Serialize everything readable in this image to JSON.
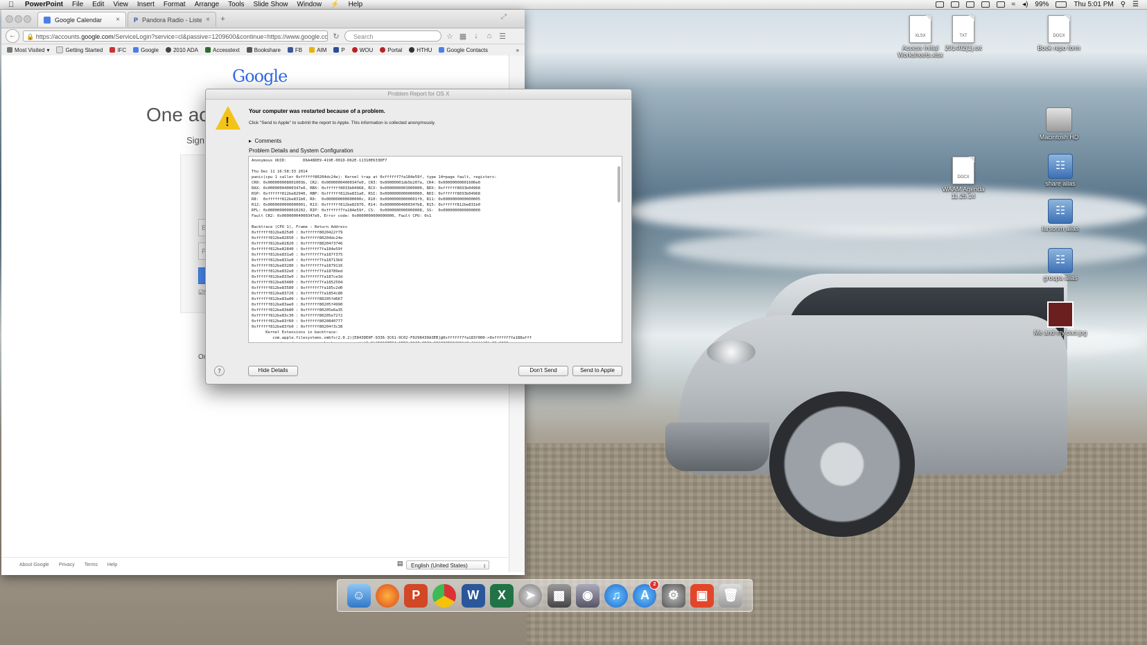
{
  "menubar": {
    "app": "PowerPoint",
    "items": [
      "File",
      "Edit",
      "View",
      "Insert",
      "Format",
      "Arrange",
      "Tools",
      "Slide Show",
      "Window",
      "Help"
    ],
    "battery": "99%",
    "clock": "Thu 5:01 PM"
  },
  "desktop": {
    "icons": [
      {
        "label": "Access Initial Worksheets.xlsx",
        "tag": "XLSX"
      },
      {
        "label": "201402(1).txt",
        "tag": "TXT"
      },
      {
        "label": "Book repo form",
        "tag": "DOCX"
      },
      {
        "label": "Macintosh HD"
      },
      {
        "label": "WAAM Agenda 11.25.14",
        "tag": "DOCX"
      },
      {
        "label": "share alias"
      },
      {
        "label": "larsonm alias"
      },
      {
        "label": "groupa alias"
      },
      {
        "label": "Me and my dad.jpg"
      }
    ]
  },
  "browser": {
    "tabs": [
      {
        "label": "Google Calendar"
      },
      {
        "label": "Pandora Radio - Listen to ..."
      }
    ],
    "url_prefix": "https://accounts.",
    "url_domain": "google.com",
    "url_rest": "/ServiceLogin?service=cl&passive=1209600&continue=https://www.google.com/caler",
    "search_placeholder": "Search",
    "bookmarks": [
      "Most Visited",
      "Getting Started",
      "IFC",
      "Google",
      "2010 ADA",
      "Accesstext",
      "Bookshare",
      "FB",
      "AIM",
      "P",
      "WOU",
      "Portal",
      "HTHU",
      "Google Contacts"
    ],
    "page": {
      "logo": "Google",
      "heading": "One acc",
      "subheading": "Sign i",
      "field1": "Er",
      "field2": "Pa",
      "remember": "S",
      "footer_fragment": "On",
      "footer_links": [
        "About Google",
        "Privacy",
        "Terms",
        "Help"
      ],
      "language": "English (United States)"
    }
  },
  "dialog": {
    "title": "Problem Report for OS X",
    "headline": "Your computer was restarted because of a problem.",
    "description": "Click \"Send to Apple\" to submit the report to Apple. This information is collected anonymously.",
    "comments_label": "Comments",
    "details_label": "Problem Details and System Configuration",
    "report_text": "Anonymous UUID:       D6A48DE9-419E-001D-D62E-11310E633DF7\n\nThu Dec 11 16:58:33 2014\npanic(cpu 1 caller 0xffffff80204dc24e): Kernel trap at 0xffffff7fa184e59f, type 14=page fault, registers:\nCR0: 0x000000008001003b, CR2: 0x00000004000347e0, CR3: 0x00000001db5b207a, CR4: 0x00000000001606e0\nRAX: 0x00000004000347e0, RBX: 0xffffff8033b04968, RCX: 0x0000000003000000, RDX: 0xffffff8033b04968\nRSP: 0xffffff812be82940, RBP: 0xffffff812be831a0, RSI: 0x0000000000000000, RDI: 0xffffff8033b04968\nR8:  0xffffff812be831b0, R9:  0x000000000000000c, R10: 0x00000000000001f0, R11: 0x0000000000000005\nR12: 0x0000000000000001, R13: 0xffffff812be82970, R14: 0x00000004000347b8, R15: 0xffffff812be831b0\nRFL: 0x0000000000010202, RIP: 0xffffff7fa184e59f, CS:  0x0000000000000008, SS:  0x0000000000000000\nFault CR2: 0x00000004000347e0, Error code: 0x0000000000000000, Fault CPU: 0x1\n\nBacktrace (CPU 1), Frame : Return Address\n0xffffff812be825d0 : 0xffffff8020422f79\n0xffffff812be82650 : 0xffffff80204dc24e\n0xffffff812be82820 : 0xffffff80204f3746\n0xffffff812be82840 : 0xffffff7fa184e59f\n0xffffff812be831a0 : 0xffffff7fa187f375\n0xffffff812be831e0 : 0xffffff7fa18713b9\n0xffffff812be83280 : 0xffffff7fa1879116\n0xffffff812be832e0 : 0xffffff7fa18789ed\n0xffffff812be833e0 : 0xffffff7fa187ce3d\n0xffffff812be83480 : 0xffffff7fa1852504\n0xffffff812be83580 : 0xffffff7fa185c2d0\n0xffffff812be83720 : 0xffffff7fa1854c80\n0xffffff812be83a00 : 0xffffff80205fd667\n0xffffff812be83ae0 : 0xffffff80205f4990\n0xffffff812be83b80 : 0xffffff80205e6a35\n0xffffff812be83c30 : 0xffffff80205e72f2\n0xffffff812be83f60 : 0xffffff8020840777\n0xffffff812be83fb0 : 0xffffff80204f3c38\n      Kernel Extensions in backtrace:\n         com.apple.filesystems.smbfs(2.0.2)[E843DE0F-9336-3C61-9C02-F0298430A3EB]@0xffffff7fa183f000->0xffffff7fa188afff\n            dependency: com.apple.kec.corecrypto(1.0)[D0137B94-65D2-32AF-858C-00A360E104C3]@0xffffff7fa09a9000\n            dependency: com.apple.kext.triggers(1.0)[A7018A2E-1C0C-3788-9382-67786A396EAF]@0xffffff7fa1280000\n\nBSD process name corresponding to current thread: Microsoft Word",
    "hide_details": "Hide Details",
    "dont_send": "Don't Send",
    "send": "Send to Apple"
  },
  "dock": {
    "appstore_badge": "2"
  }
}
